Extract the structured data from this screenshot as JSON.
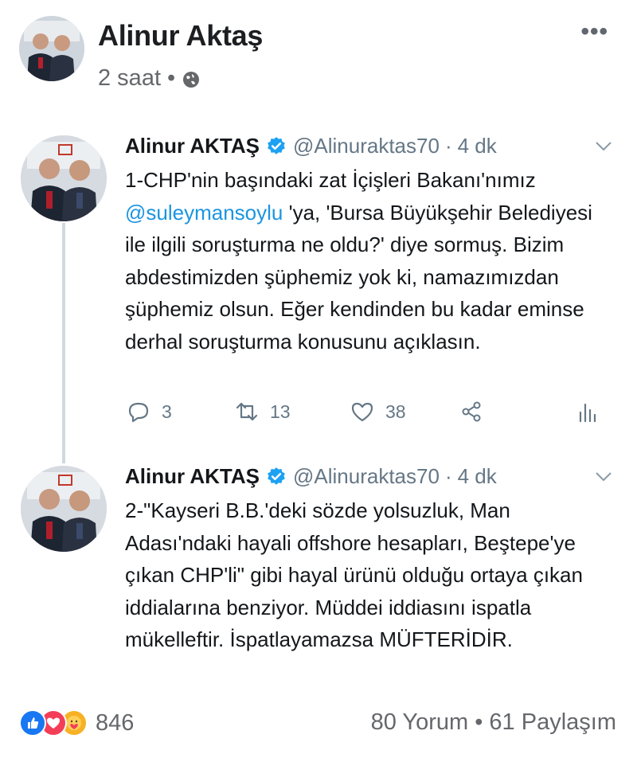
{
  "post": {
    "author": "Alinur Aktaş",
    "time": "2 saat",
    "dot": "•",
    "more": "•••"
  },
  "tweets": [
    {
      "name": "Alinur AKTAŞ",
      "handle": "@Alinuraktas70",
      "sep": "·",
      "time": "4 dk",
      "text_before": "1-CHP'nin başındaki zat İçişleri Bakanı'nımız ",
      "mention": "@suleymansoylu",
      "text_after": " 'ya, 'Bursa Büyükşehir Belediyesi ile ilgili soruşturma ne oldu?' diye sormuş. Bizim abdestimizden şüphemiz yok ki, namazımızdan şüphemiz olsun. Eğer kendinden bu kadar eminse derhal soruşturma konusunu açıklasın.",
      "replies": "3",
      "retweets": "13",
      "likes": "38"
    },
    {
      "name": "Alinur AKTAŞ",
      "handle": "@Alinuraktas70",
      "sep": "·",
      "time": "4 dk",
      "text": "2-\"Kayseri B.B.'deki sözde yolsuzluk, Man Adası'ndaki hayali offshore hesapları, Beştepe'ye çıkan CHP'li\" gibi hayal ürünü olduğu ortaya çıkan iddialarına benziyor. Müddei iddiasını ispatla mükelleftir. İspatlayamazsa MÜFTERİDİR."
    }
  ],
  "footer": {
    "reaction_count": "846",
    "comments": "80 Yorum",
    "dot": "•",
    "shares": "61 Paylaşım"
  },
  "colors": {
    "twitter_blue": "#1da1f2",
    "mention_blue": "#1b95e0",
    "fb_like": "#1877f2"
  }
}
